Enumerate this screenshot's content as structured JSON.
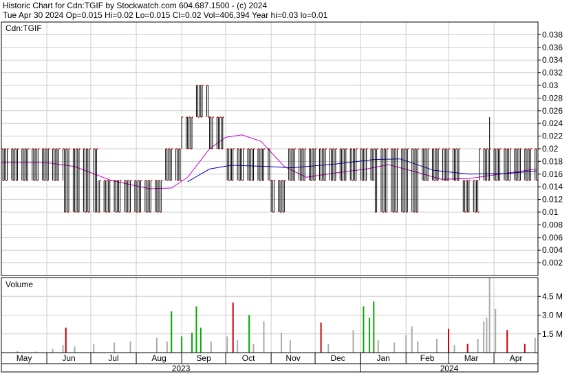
{
  "header": {
    "title_line": "Historic Chart for Cdn:TGIF by Stockwatch.com 604.687.1500 - (c) 2024",
    "quote_line": "Tue Apr 30 2024  Op=0.015  Hi=0.02  Lo=0.015  Cl=0.02  Vol=406,394  Year hi=0.03  lo=0.01"
  },
  "chart_data": [
    {
      "type": "ohlc",
      "symbol_label": "Cdn:TGIF",
      "y_axis_position": "right",
      "ylim": [
        0,
        0.04
      ],
      "y_ticks": [
        "0.038",
        "0.036",
        "0.034",
        "0.032",
        "0.03",
        "0.028",
        "0.026",
        "0.024",
        "0.022",
        "0.02",
        "0.018",
        "0.016",
        "0.014",
        "0.012",
        "0.01",
        "0.008",
        "0.006",
        "0.004",
        "0.002"
      ],
      "x_months": [
        "May",
        "Jun",
        "Jul",
        "Aug",
        "Sep",
        "Oct",
        "Nov",
        "Dec",
        "Jan",
        "Feb",
        "Mar",
        "Apr"
      ],
      "x_years": [
        "2023",
        "2024"
      ],
      "grid": true,
      "price_bar_color": "#000000",
      "close_tick_color": "#cc0000",
      "series": [
        {
          "type": "ohlc",
          "x_range": [
            "2023-05-01",
            "2024-04-30"
          ],
          "segments": [
            {
              "from": "2023-05-01",
              "to": "2023-06-12",
              "high": 0.02,
              "low": 0.015
            },
            {
              "from": "2023-06-13",
              "to": "2023-07-05",
              "high": 0.02,
              "low": 0.01
            },
            {
              "from": "2023-07-06",
              "to": "2023-08-20",
              "high": 0.015,
              "low": 0.01
            },
            {
              "from": "2023-08-21",
              "to": "2023-08-31",
              "high": 0.02,
              "low": 0.015
            },
            {
              "from": "2023-09-01",
              "to": "2023-09-09",
              "high": 0.025,
              "low": 0.02
            },
            {
              "from": "2023-09-10",
              "to": "2023-09-19",
              "high": 0.03,
              "low": 0.025
            },
            {
              "from": "2023-09-20",
              "to": "2023-10-01",
              "high": 0.025,
              "low": 0.02
            },
            {
              "from": "2023-10-02",
              "to": "2023-10-31",
              "high": 0.02,
              "low": 0.015
            },
            {
              "from": "2023-11-01",
              "to": "2023-11-12",
              "high": 0.015,
              "low": 0.01
            },
            {
              "from": "2023-11-13",
              "to": "2024-01-10",
              "high": 0.02,
              "low": 0.015
            },
            {
              "from": "2024-01-11",
              "to": "2024-02-10",
              "high": 0.02,
              "low": 0.01
            },
            {
              "from": "2024-02-11",
              "to": "2024-03-08",
              "high": 0.02,
              "low": 0.015
            },
            {
              "from": "2024-03-09",
              "to": "2024-03-21",
              "high": 0.015,
              "low": 0.01
            },
            {
              "from": "2024-03-22",
              "to": "2024-04-30",
              "high": 0.02,
              "low": 0.015
            }
          ],
          "extra_highs": [
            {
              "date": "2024-03-29",
              "high": 0.025
            }
          ]
        },
        {
          "type": "line",
          "color": "#cc00cc",
          "x": [
            "2023-05-01",
            "2023-06-01",
            "2023-06-20",
            "2023-07-15",
            "2023-08-10",
            "2023-08-25",
            "2023-09-05",
            "2023-09-20",
            "2023-10-01",
            "2023-10-12",
            "2023-10-25",
            "2023-11-10",
            "2023-11-25",
            "2023-12-15",
            "2024-01-05",
            "2024-01-20",
            "2024-02-10",
            "2024-02-25",
            "2024-03-15",
            "2024-04-05",
            "2024-04-30"
          ],
          "y": [
            0.0178,
            0.0178,
            0.0172,
            0.015,
            0.0137,
            0.0138,
            0.0155,
            0.02,
            0.0218,
            0.0222,
            0.0212,
            0.0172,
            0.0155,
            0.0162,
            0.0168,
            0.0175,
            0.0162,
            0.0152,
            0.0153,
            0.016,
            0.0168
          ]
        },
        {
          "type": "line",
          "color": "#0000cc",
          "x": [
            "2023-09-05",
            "2023-09-20",
            "2023-10-05",
            "2023-10-30",
            "2023-11-15",
            "2023-12-15",
            "2024-01-10",
            "2024-01-28",
            "2024-02-20",
            "2024-03-15",
            "2024-04-10",
            "2024-04-30"
          ],
          "y": [
            0.0148,
            0.0168,
            0.0174,
            0.0172,
            0.017,
            0.0176,
            0.0183,
            0.0184,
            0.0166,
            0.016,
            0.0161,
            0.0165
          ]
        }
      ]
    },
    {
      "type": "bar",
      "title": "Volume",
      "y_axis_position": "right",
      "ylim": [
        0,
        6.0
      ],
      "y_ticks": [
        "4.5 M",
        "3.0 M",
        "1.5 M"
      ],
      "grid": true,
      "color_up": "#00aa00",
      "color_down": "#cc0000",
      "color_flat": "#aaaaaa",
      "bars": [
        {
          "date": "2023-05-12",
          "value": 0.12,
          "dir": "flat"
        },
        {
          "date": "2023-05-25",
          "value": 0.1,
          "dir": "flat"
        },
        {
          "date": "2023-06-05",
          "value": 0.3,
          "dir": "flat"
        },
        {
          "date": "2023-06-12",
          "value": 0.6,
          "dir": "flat"
        },
        {
          "date": "2023-06-14",
          "value": 2.0,
          "dir": "down"
        },
        {
          "date": "2023-06-20",
          "value": 0.5,
          "dir": "flat"
        },
        {
          "date": "2023-07-03",
          "value": 0.7,
          "dir": "flat"
        },
        {
          "date": "2023-07-17",
          "value": 0.8,
          "dir": "flat"
        },
        {
          "date": "2023-07-28",
          "value": 0.9,
          "dir": "flat"
        },
        {
          "date": "2023-08-15",
          "value": 1.2,
          "dir": "flat"
        },
        {
          "date": "2023-08-22",
          "value": 0.9,
          "dir": "flat"
        },
        {
          "date": "2023-08-25",
          "value": 3.3,
          "dir": "up"
        },
        {
          "date": "2023-09-01",
          "value": 1.3,
          "dir": "up"
        },
        {
          "date": "2023-09-08",
          "value": 1.6,
          "dir": "up"
        },
        {
          "date": "2023-09-11",
          "value": 3.7,
          "dir": "up"
        },
        {
          "date": "2023-09-14",
          "value": 2.0,
          "dir": "up"
        },
        {
          "date": "2023-09-21",
          "value": 0.9,
          "dir": "flat"
        },
        {
          "date": "2023-10-02",
          "value": 1.3,
          "dir": "flat"
        },
        {
          "date": "2023-10-06",
          "value": 4.0,
          "dir": "down"
        },
        {
          "date": "2023-10-09",
          "value": 1.0,
          "dir": "flat"
        },
        {
          "date": "2023-10-17",
          "value": 3.0,
          "dir": "up"
        },
        {
          "date": "2023-10-20",
          "value": 0.7,
          "dir": "flat"
        },
        {
          "date": "2023-10-27",
          "value": 2.5,
          "dir": "flat"
        },
        {
          "date": "2023-11-08",
          "value": 1.6,
          "dir": "flat"
        },
        {
          "date": "2023-11-14",
          "value": 1.0,
          "dir": "flat"
        },
        {
          "date": "2023-12-05",
          "value": 2.4,
          "dir": "down"
        },
        {
          "date": "2023-12-10",
          "value": 0.7,
          "dir": "flat"
        },
        {
          "date": "2023-12-27",
          "value": 1.8,
          "dir": "flat"
        },
        {
          "date": "2024-01-03",
          "value": 3.7,
          "dir": "up"
        },
        {
          "date": "2024-01-07",
          "value": 2.8,
          "dir": "up"
        },
        {
          "date": "2024-01-10",
          "value": 4.1,
          "dir": "up"
        },
        {
          "date": "2024-01-13",
          "value": 1.0,
          "dir": "flat"
        },
        {
          "date": "2024-01-24",
          "value": 0.8,
          "dir": "flat"
        },
        {
          "date": "2024-02-01",
          "value": 1.4,
          "dir": "flat"
        },
        {
          "date": "2024-02-05",
          "value": 2.1,
          "dir": "flat"
        },
        {
          "date": "2024-02-09",
          "value": 0.9,
          "dir": "flat"
        },
        {
          "date": "2024-02-22",
          "value": 1.1,
          "dir": "flat"
        },
        {
          "date": "2024-03-01",
          "value": 1.9,
          "dir": "down"
        },
        {
          "date": "2024-03-05",
          "value": 0.6,
          "dir": "flat"
        },
        {
          "date": "2024-03-14",
          "value": 0.7,
          "dir": "down"
        },
        {
          "date": "2024-03-21",
          "value": 1.1,
          "dir": "flat"
        },
        {
          "date": "2024-03-25",
          "value": 2.5,
          "dir": "flat"
        },
        {
          "date": "2024-03-27",
          "value": 2.8,
          "dir": "flat"
        },
        {
          "date": "2024-03-29",
          "value": 10.0,
          "dir": "flat"
        },
        {
          "date": "2024-04-02",
          "value": 3.5,
          "dir": "flat"
        },
        {
          "date": "2024-04-10",
          "value": 1.8,
          "dir": "down"
        },
        {
          "date": "2024-04-22",
          "value": 0.7,
          "dir": "down"
        },
        {
          "date": "2024-04-29",
          "value": 1.2,
          "dir": "flat"
        }
      ]
    }
  ]
}
